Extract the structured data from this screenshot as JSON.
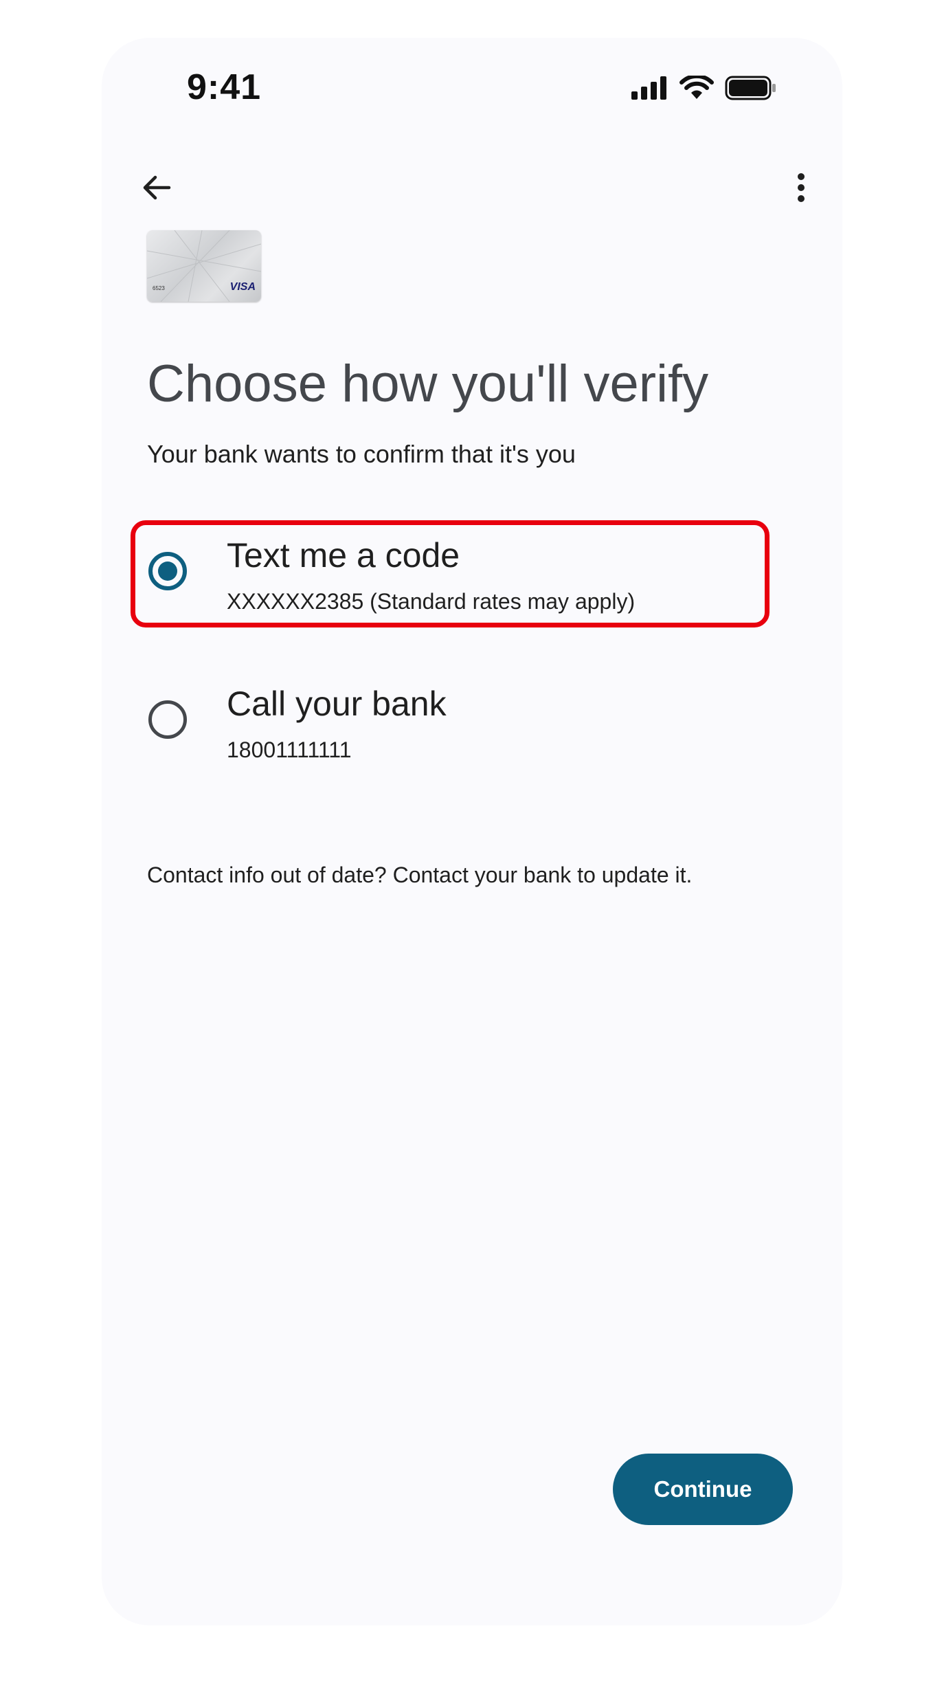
{
  "status_bar": {
    "time": "9:41"
  },
  "top_bar": {
    "back_icon": "arrow-back-icon",
    "more_icon": "more-vert-icon"
  },
  "card": {
    "last_digits": "6523",
    "network": "VISA"
  },
  "page": {
    "title": "Choose how you'll verify",
    "subtitle": "Your bank wants to confirm that it's you"
  },
  "options": [
    {
      "title": "Text me a code",
      "detail": "XXXXXX2385 (Standard rates may apply)",
      "selected": true
    },
    {
      "title": "Call your bank",
      "detail": "18001111111",
      "selected": false
    }
  ],
  "contact_note": "Contact info out of date? Contact your bank to update it.",
  "continue_label": "Continue",
  "colors": {
    "accent": "#0e5f80",
    "highlight": "#e8000e",
    "background": "#fafafd"
  }
}
